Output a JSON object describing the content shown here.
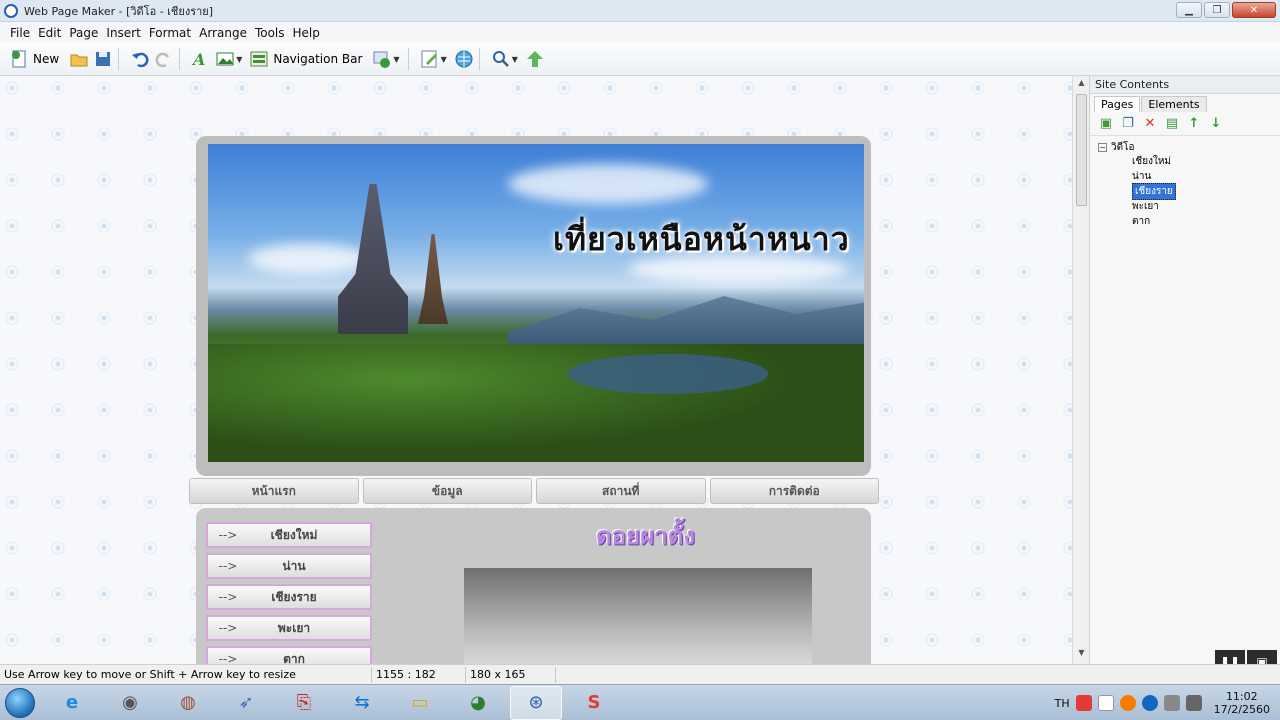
{
  "window": {
    "title": "Web Page Maker - [วิดีโอ - เชียงราย]",
    "min": "▁",
    "max": "❐",
    "close": "✕"
  },
  "menu": [
    "File",
    "Edit",
    "Page",
    "Insert",
    "Format",
    "Arrange",
    "Tools",
    "Help"
  ],
  "toolbar": {
    "new_label": "New",
    "navbar_label": "Navigation Bar"
  },
  "page": {
    "headline": "เที่ยวเหนือหน้าหนาว",
    "nav": [
      "หน้าแรก",
      "ข้อมูล",
      "สถานที่",
      "การติดต่อ"
    ],
    "side_arrow": "-->",
    "side": [
      "เชียงใหม่",
      "น่าน",
      "เชียงราย",
      "พะเยา",
      "ตาก"
    ],
    "content_title": "ดอยผาตั้ง"
  },
  "panel": {
    "title": "Site Contents",
    "tabs": [
      "Pages",
      "Elements"
    ],
    "tree_root": "วิดีโอ",
    "tree_items": [
      "เชียงใหม่",
      "น่าน",
      "เชียงราย",
      "พะเยา",
      "ตาก"
    ],
    "selected_index": 2
  },
  "status": {
    "hint": "Use Arrow key to move or Shift + Arrow key to resize",
    "position": "1155 : 182",
    "size": "180 x 165"
  },
  "taskbar": {
    "lang": "TH",
    "time": "11:02",
    "date": "17/2/2560"
  },
  "colors": {
    "selection": "#3375d6",
    "menu_border": "#d7a6e0",
    "title_purple": "#b68ae0"
  }
}
